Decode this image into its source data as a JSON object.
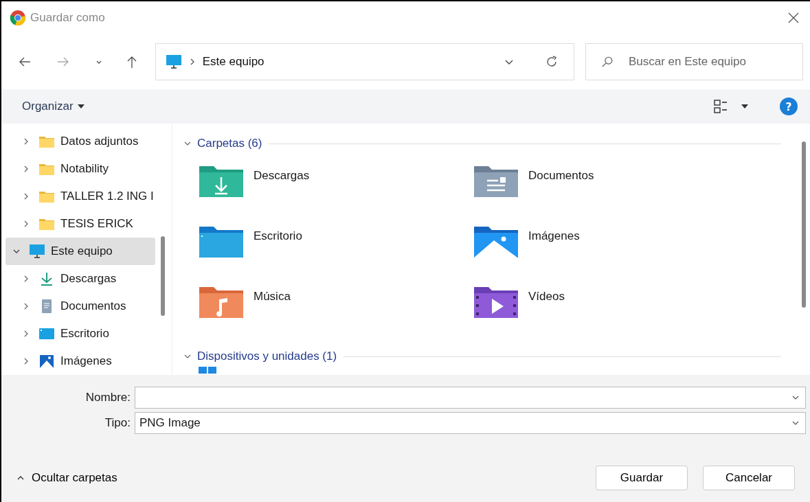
{
  "window": {
    "title": "Guardar como"
  },
  "nav": {
    "address": "Este equipo",
    "search_placeholder": "Buscar en Este equipo"
  },
  "toolbar": {
    "organize": "Organizar",
    "help": "?"
  },
  "sidebar": {
    "scrolled_children": [
      {
        "label": "Datos adjuntos",
        "kind": "folder",
        "selected": false
      },
      {
        "label": "Notability",
        "kind": "folder",
        "selected": false
      },
      {
        "label": "TALLER 1.2 ING I",
        "kind": "folder",
        "selected": false
      },
      {
        "label": "TESIS ERICK",
        "kind": "folder",
        "selected": false
      }
    ],
    "items": [
      {
        "label": "Este equipo",
        "kind": "pc",
        "expanded": true,
        "selected": true,
        "children": [
          {
            "label": "Descargas",
            "kind": "download",
            "selected": false
          },
          {
            "label": "Documentos",
            "kind": "documents",
            "selected": false
          },
          {
            "label": "Escritorio",
            "kind": "desktop",
            "selected": false
          },
          {
            "label": "Imágenes",
            "kind": "pictures",
            "selected": false
          }
        ]
      }
    ]
  },
  "groups": [
    {
      "title": "Carpetas (6)",
      "expanded": true,
      "items": [
        {
          "name": "Descargas",
          "kind": "download"
        },
        {
          "name": "Documentos",
          "kind": "documents"
        },
        {
          "name": "Escritorio",
          "kind": "desktop"
        },
        {
          "name": "Imágenes",
          "kind": "pictures"
        },
        {
          "name": "Música",
          "kind": "music"
        },
        {
          "name": "Vídeos",
          "kind": "videos"
        }
      ]
    },
    {
      "title": "Dispositivos y unidades (1)",
      "expanded": true,
      "items": [
        {
          "kind": "drive"
        }
      ]
    }
  ],
  "fields": [
    {
      "label": "Nombre:"
    },
    {
      "label": "Tipo:",
      "value": "PNG Image"
    }
  ],
  "hide_folders": "Ocultar carpetas",
  "buttons": [
    "Guardar",
    "Cancelar"
  ]
}
